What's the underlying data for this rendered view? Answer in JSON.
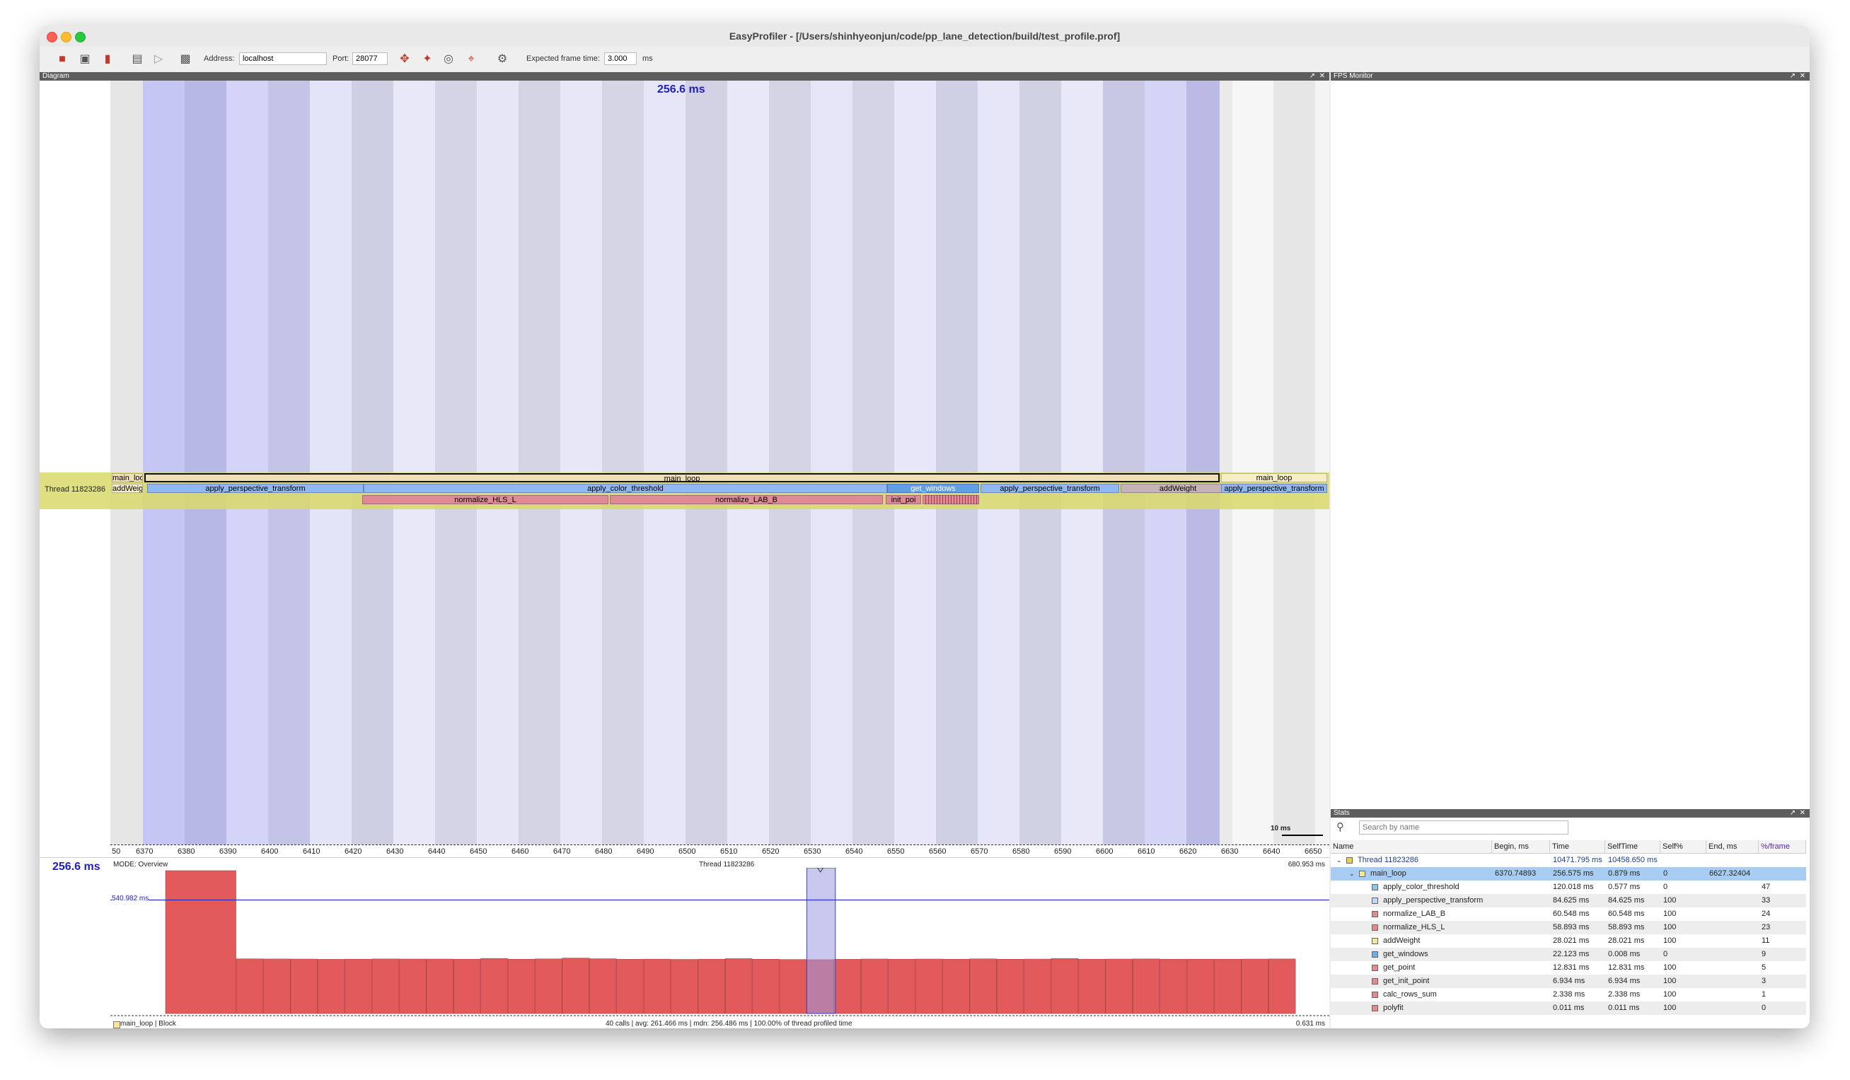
{
  "window": {
    "title": "EasyProfiler - [/Users/shinhyeonjun/code/pp_lane_detection/build/test_profile.prof]"
  },
  "toolbar": {
    "address_label": "Address:",
    "address_value": "localhost",
    "port_label": "Port:",
    "port_value": "28077",
    "frame_label": "Expected frame time:",
    "frame_value": "3.000",
    "frame_unit": "ms"
  },
  "diagram": {
    "panel_title": "Diagram",
    "selection_label": "256.6 ms",
    "thread_label": "Thread 11823286",
    "scale_label": "10 ms",
    "ticks": [
      "50",
      "6370",
      "6380",
      "6390",
      "6400",
      "6410",
      "6420",
      "6430",
      "6440",
      "6450",
      "6460",
      "6470",
      "6480",
      "6490",
      "6500",
      "6510",
      "6520",
      "6530",
      "6540",
      "6550",
      "6560",
      "6570",
      "6580",
      "6590",
      "6600",
      "6610",
      "6620",
      "6630",
      "6640",
      "6650"
    ],
    "blocks": {
      "main_loop_a": "main_loop",
      "main_loop_b": "main_loop",
      "main_loop_c": "main_loop",
      "addweight_a": "addWeight",
      "apt_a": "apply_perspective_transform",
      "act": "apply_color_threshold",
      "get_windows": "get_windows",
      "apt_b": "apply_perspective_transform",
      "addweight_b": "addWeight",
      "apt_c": "apply_perspective_transform",
      "hls": "normalize_HLS_L",
      "lab": "normalize_LAB_B",
      "init": "init_poi"
    }
  },
  "overview": {
    "duration": "256.6 ms",
    "mode": "MODE: Overview",
    "thread": "Thread 11823286",
    "max_value": "680.953 ms",
    "threshold": "540.982 ms",
    "min_value": "0.631 ms",
    "legend": "main_loop | Block",
    "summary": "40 calls | avg: 261.466 ms | mdn: 256.486 ms | 100.00% of thread profiled time"
  },
  "histogram": {
    "bars_ms": [
      680.9,
      260.5,
      259.8,
      259.3,
      258.2,
      259.0,
      260.1,
      259.5,
      259.4,
      258.8,
      262.4,
      258.7,
      260.3,
      264.1,
      261.0,
      258.4,
      259.1,
      257.8,
      258.9,
      261.5,
      258.6,
      257.4,
      256.6,
      258.3,
      259.7,
      258.8,
      259.5,
      258.7,
      260.4,
      258.6,
      259.2,
      262.1,
      258.8,
      259.4,
      260.2,
      258.7,
      259.0,
      258.9,
      259.3,
      260.0
    ],
    "selected_index": 22,
    "threshold_ms": 540.982,
    "max_ms": 680.953
  },
  "fps": {
    "panel_title": "FPS Monitor"
  },
  "stats": {
    "panel_title": "Stats",
    "search_placeholder": "Search by name",
    "columns": [
      "Name",
      "Begin, ms",
      "Time",
      "SelfTime",
      "Self%",
      "End, ms",
      "%/frame"
    ],
    "rows": [
      {
        "name": "Thread 11823286",
        "begin": "",
        "time": "10471.795 ms",
        "self": "10458.650 ms",
        "pct": "",
        "end": "",
        "frame": "",
        "color": "#e9d24a",
        "indent": 0,
        "expander": "v"
      },
      {
        "name": "main_loop",
        "begin": "6370.74893",
        "time": "256.575 ms",
        "self": "0.879 ms",
        "pct": "0",
        "end": "6627.32404",
        "frame": "",
        "color": "#f3e79a",
        "indent": 1,
        "expander": "v"
      },
      {
        "name": "apply_color_threshold",
        "begin": "",
        "time": "120.018 ms",
        "self": "0.577 ms",
        "pct": "0",
        "end": "",
        "frame": "47",
        "color": "#8ec5ec",
        "indent": 2,
        "expander": ""
      },
      {
        "name": "apply_perspective_transform",
        "begin": "",
        "time": "84.625 ms",
        "self": "84.625 ms",
        "pct": "100",
        "end": "",
        "frame": "33",
        "color": "#bcd9f3",
        "indent": 2,
        "expander": ""
      },
      {
        "name": "normalize_LAB_B",
        "begin": "",
        "time": "60.548 ms",
        "self": "60.548 ms",
        "pct": "100",
        "end": "",
        "frame": "24",
        "color": "#e38a91",
        "indent": 2,
        "expander": ""
      },
      {
        "name": "normalize_HLS_L",
        "begin": "",
        "time": "58.893 ms",
        "self": "58.893 ms",
        "pct": "100",
        "end": "",
        "frame": "23",
        "color": "#e38a91",
        "indent": 2,
        "expander": ""
      },
      {
        "name": "addWeight",
        "begin": "",
        "time": "28.021 ms",
        "self": "28.021 ms",
        "pct": "100",
        "end": "",
        "frame": "11",
        "color": "#f3e79a",
        "indent": 2,
        "expander": ""
      },
      {
        "name": "get_windows",
        "begin": "",
        "time": "22.123 ms",
        "self": "0.008 ms",
        "pct": "0",
        "end": "",
        "frame": "9",
        "color": "#6aaee6",
        "indent": 2,
        "expander": ""
      },
      {
        "name": "get_point",
        "begin": "",
        "time": "12.831 ms",
        "self": "12.831 ms",
        "pct": "100",
        "end": "",
        "frame": "5",
        "color": "#e38a91",
        "indent": 2,
        "expander": ""
      },
      {
        "name": "get_init_point",
        "begin": "",
        "time": "6.934 ms",
        "self": "6.934 ms",
        "pct": "100",
        "end": "",
        "frame": "3",
        "color": "#e38a91",
        "indent": 2,
        "expander": ""
      },
      {
        "name": "calc_rows_sum",
        "begin": "",
        "time": "2.338 ms",
        "self": "2.338 ms",
        "pct": "100",
        "end": "",
        "frame": "1",
        "color": "#e38a91",
        "indent": 2,
        "expander": ""
      },
      {
        "name": "polyfit",
        "begin": "",
        "time": "0.011 ms",
        "self": "0.011 ms",
        "pct": "100",
        "end": "",
        "frame": "0",
        "color": "#e38a91",
        "indent": 2,
        "expander": ""
      }
    ]
  },
  "colors": {
    "accent": "#2020c0",
    "bar": "#e35a5c",
    "selection": "#a8a8e8",
    "thread_bg": "#d8d96a"
  }
}
